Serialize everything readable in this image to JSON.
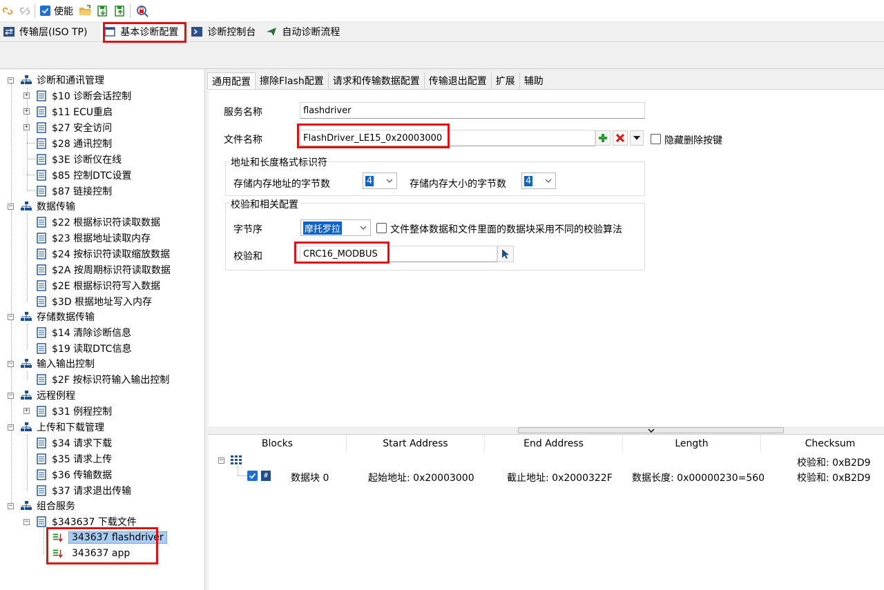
{
  "toolbar": {
    "enable_label": "使能",
    "icons": [
      "link-icon",
      "unlink-icon",
      "open-folder-icon",
      "import-icon",
      "export-icon",
      "diagnose-icon"
    ]
  },
  "tabs": [
    {
      "label": "传输层(ISO TP)",
      "icon": "arrows-icon"
    },
    {
      "label": "基本诊断配置",
      "icon": "window-icon"
    },
    {
      "label": "诊断控制台",
      "icon": "console-icon"
    },
    {
      "label": "自动诊断流程",
      "icon": "send-icon"
    }
  ],
  "tree": {
    "groups": [
      {
        "label": "诊断和通讯管理",
        "items": [
          "$10 诊断会话控制",
          "$11 ECU重启",
          "$27 安全访问",
          "$28 通讯控制",
          "$3E 诊断仪在线",
          "$85 控制DTC设置",
          "$87 链接控制"
        ]
      },
      {
        "label": "数据传输",
        "items": [
          "$22 根据标识符读取数据",
          "$23 根据地址读取内存",
          "$24 按标识符读取缩放数据",
          "$2A 按周期标识符读取数据",
          "$2E 根据标识符写入数据",
          "$3D 根据地址写入内存"
        ]
      },
      {
        "label": "存储数据传输",
        "items": [
          "$14 清除诊断信息",
          "$19 读取DTC信息"
        ]
      },
      {
        "label": "输入输出控制",
        "items": [
          "$2F 按标识符输入输出控制"
        ]
      },
      {
        "label": "远程例程",
        "items": [
          "$31 例程控制"
        ]
      },
      {
        "label": "上传和下载管理",
        "items": [
          "$34 请求下载",
          "$35 请求上传",
          "$36 传输数据",
          "$37 请求退出传输"
        ]
      },
      {
        "label": "组合服务",
        "items": [
          "$343637 下载文件"
        ]
      }
    ],
    "sub_items": [
      "343637 flashdriver",
      "343637 app"
    ]
  },
  "subtabs": [
    "通用配置",
    "擦除Flash配置",
    "请求和传输数据配置",
    "传输退出配置",
    "扩展",
    "辅助"
  ],
  "form": {
    "service_name_label": "服务名称",
    "service_name_value": "flashdriver",
    "file_name_label": "文件名称",
    "file_name_value": "FlashDriver_LE15_0x20003000",
    "hide_delete_label": "隐藏删除按键",
    "addr_group_legend": "地址和长度格式标识符",
    "addr_bytes_label": "存储内存地址的字节数",
    "addr_bytes_value": "4",
    "size_bytes_label": "存储内存大小的字节数",
    "size_bytes_value": "4",
    "checksum_group_legend": "校验和相关配置",
    "byte_order_label": "字节序",
    "byte_order_value": "摩托罗拉",
    "diff_algo_label": "文件整体数据和文件里面的数据块采用不同的校验算法",
    "checksum_label": "校验和",
    "checksum_value": "CRC16_MODBUS"
  },
  "blocks": {
    "headers": [
      "Blocks",
      "Start Address",
      "End Address",
      "Length",
      "Checksum"
    ],
    "root_checksum": "校验和: 0xB2D9",
    "rows": [
      {
        "name": "数据块 0",
        "start": "起始地址: 0x20003000",
        "end": "截止地址: 0x2000322F",
        "length": "数据长度: 0x00000230=560",
        "checksum": "校验和: 0xB2D9"
      }
    ]
  },
  "colors": {
    "accent": "#1f6fd1",
    "highlight_box": "#e01010",
    "selection": "#a9cdf2"
  }
}
